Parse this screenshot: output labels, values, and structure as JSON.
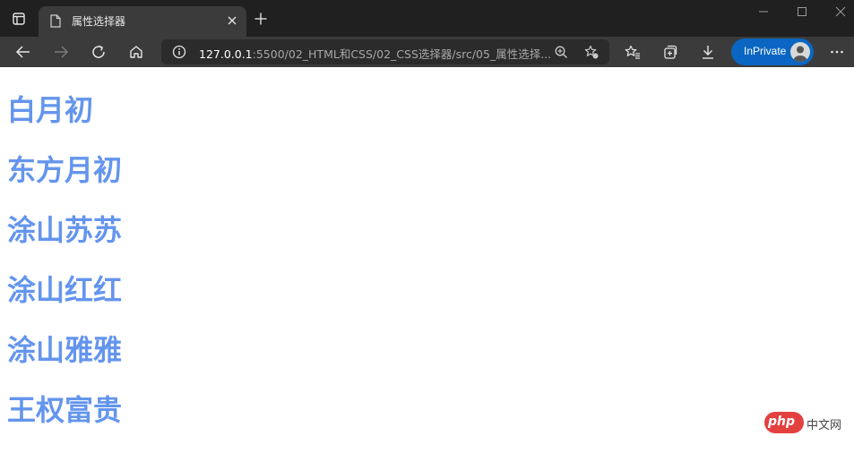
{
  "browser": {
    "tab_title": "属性选择器",
    "url_host": "127.0.0.1",
    "url_rest": ":5500/02_HTML和CSS/02_CSS选择器/src/05_属性选择...",
    "inprivate_label": "InPrivate",
    "accent_color": "#0a66c2",
    "icons": [
      "window-icon",
      "file-icon",
      "close-icon",
      "plus-icon",
      "minimize-icon",
      "maximize-icon",
      "window-close-icon",
      "back-arrow-icon",
      "forward-arrow-icon",
      "refresh-icon",
      "home-icon",
      "info-icon",
      "zoom-icon",
      "star-add-icon",
      "favorites-icon",
      "collections-icon",
      "download-icon",
      "more-icon"
    ]
  },
  "page": {
    "heading_color": "#6495ed",
    "headings": [
      "白月初",
      "东方月初",
      "涂山苏苏",
      "涂山红红",
      "涂山雅雅",
      "王权富贵"
    ]
  },
  "watermark": {
    "logo_text": "php",
    "site_text": "中文网",
    "logo_color": "#e2413f"
  }
}
